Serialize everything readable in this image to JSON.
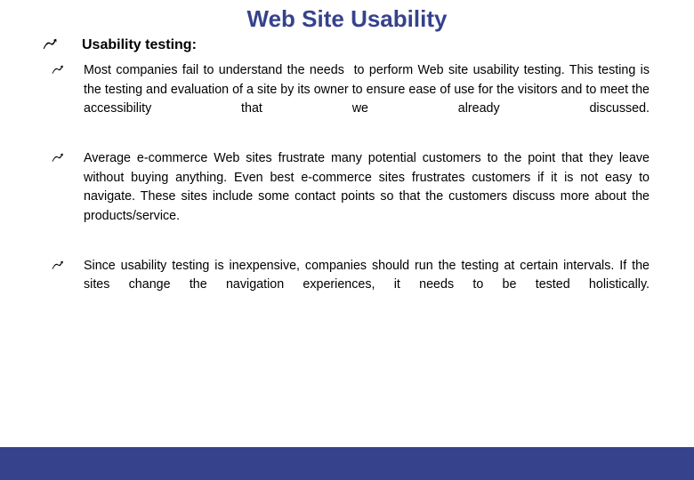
{
  "slide": {
    "title": "Web Site Usability",
    "title_color": "#36428c",
    "footer_color": "#36428c",
    "background_color": "#ffffff",
    "bullet_glyph_name": "zigzag-arrow-bullet",
    "heading": {
      "text": "Usability testing:",
      "glyph": "zigzag-arrow-bullet"
    },
    "bullets": [
      {
        "glyph": "zigzag-arrow-bullet",
        "text": "Most companies fail to understand the needs  to perform Web site usability testing. This testing is the testing and evaluation of a site by its owner to ensure ease of use for the visitors and to meet the accessibility that we already discussed."
      },
      {
        "glyph": "zigzag-arrow-bullet",
        "text": "Average e-commerce Web sites frustrate many potential customers to the point that they leave without buying anything. Even best e-commerce sites frustrates customers if it is not easy to navigate. These sites include some contact points so that the customers discuss more about the products/service."
      },
      {
        "glyph": "zigzag-arrow-bullet",
        "text": "Since usability testing is inexpensive, companies should run the testing at certain intervals. If the sites change the navigation experiences, it needs to be tested holistically."
      }
    ]
  }
}
